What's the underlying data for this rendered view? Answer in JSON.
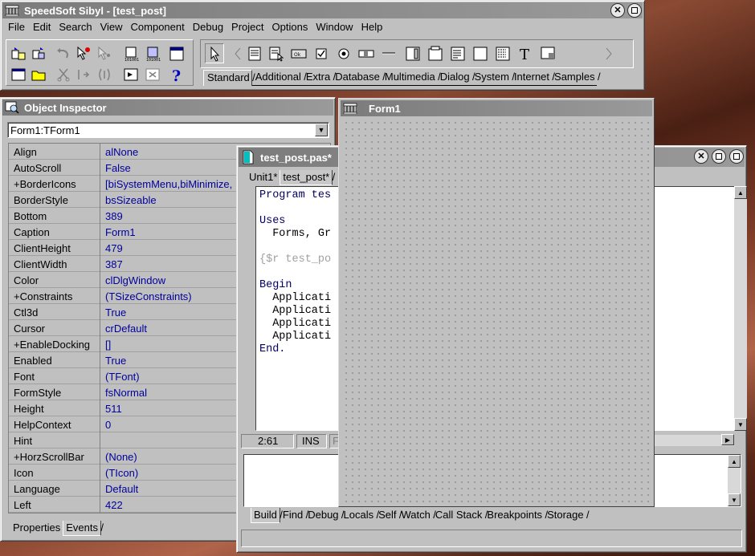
{
  "main_window": {
    "title": "SpeedSoft Sibyl  -  [test_post]",
    "menu": [
      "File",
      "Edit",
      "Search",
      "View",
      "Component",
      "Debug",
      "Project",
      "Options",
      "Window",
      "Help"
    ],
    "palette_tabs": [
      "Standard",
      "Additional",
      "Extra",
      "Database",
      "Multimedia",
      "Dialog",
      "System",
      "Internet",
      "Samples"
    ],
    "active_palette_tab": "Standard"
  },
  "object_inspector": {
    "title": "Object Inspector",
    "selected_object": "Form1:TForm1",
    "properties": [
      {
        "name": "Align",
        "value": "alNone"
      },
      {
        "name": "AutoScroll",
        "value": "False"
      },
      {
        "name": "+BorderIcons",
        "value": "[biSystemMenu,biMinimize,"
      },
      {
        "name": "BorderStyle",
        "value": "bsSizeable"
      },
      {
        "name": "Bottom",
        "value": "389"
      },
      {
        "name": "Caption",
        "value": "Form1"
      },
      {
        "name": "ClientHeight",
        "value": "479"
      },
      {
        "name": "ClientWidth",
        "value": "387"
      },
      {
        "name": "Color",
        "value": "clDlgWindow"
      },
      {
        "name": "+Constraints",
        "value": "(TSizeConstraints)"
      },
      {
        "name": "Ctl3d",
        "value": "True"
      },
      {
        "name": "Cursor",
        "value": "crDefault"
      },
      {
        "name": "+EnableDocking",
        "value": "[]"
      },
      {
        "name": "Enabled",
        "value": "True"
      },
      {
        "name": "Font",
        "value": "(TFont)"
      },
      {
        "name": "FormStyle",
        "value": "fsNormal"
      },
      {
        "name": "Height",
        "value": "511"
      },
      {
        "name": "HelpContext",
        "value": "0"
      },
      {
        "name": "Hint",
        "value": ""
      },
      {
        "name": "+HorzScrollBar",
        "value": "(None)"
      },
      {
        "name": "Icon",
        "value": "(TIcon)"
      },
      {
        "name": "Language",
        "value": "Default"
      },
      {
        "name": "Left",
        "value": "422"
      }
    ],
    "tabs": [
      "Properties",
      "Events"
    ],
    "active_tab": "Events"
  },
  "editor": {
    "title": "test_post.pas*",
    "tabs": [
      "Unit1*",
      "test_post*"
    ],
    "active_tab": "test_post*",
    "code_lines": [
      {
        "text": "Program tes",
        "style": "kw"
      },
      {
        "text": "",
        "style": "n"
      },
      {
        "text": "Uses",
        "style": "kw"
      },
      {
        "text": "  Forms, Gr",
        "style": "n"
      },
      {
        "text": "",
        "style": "n"
      },
      {
        "text": "{$r test_po",
        "style": "cm"
      },
      {
        "text": "",
        "style": "n"
      },
      {
        "text": "Begin",
        "style": "kw"
      },
      {
        "text": "  Applicati",
        "style": "n"
      },
      {
        "text": "  Applicati",
        "style": "n"
      },
      {
        "text": "  Applicati",
        "style": "n"
      },
      {
        "text": "  Applicati",
        "style": "n"
      },
      {
        "text": "End.",
        "style": "kw"
      }
    ],
    "cursor_pos": "2:61",
    "mode": "INS",
    "status_partial": "F",
    "bottom_tabs": [
      "Build",
      "Find",
      "Debug",
      "Locals",
      "Self",
      "Watch",
      "Call Stack",
      "Breakpoints",
      "Storage"
    ],
    "active_bottom_tab": "Build"
  },
  "form1": {
    "title": "Form1"
  }
}
